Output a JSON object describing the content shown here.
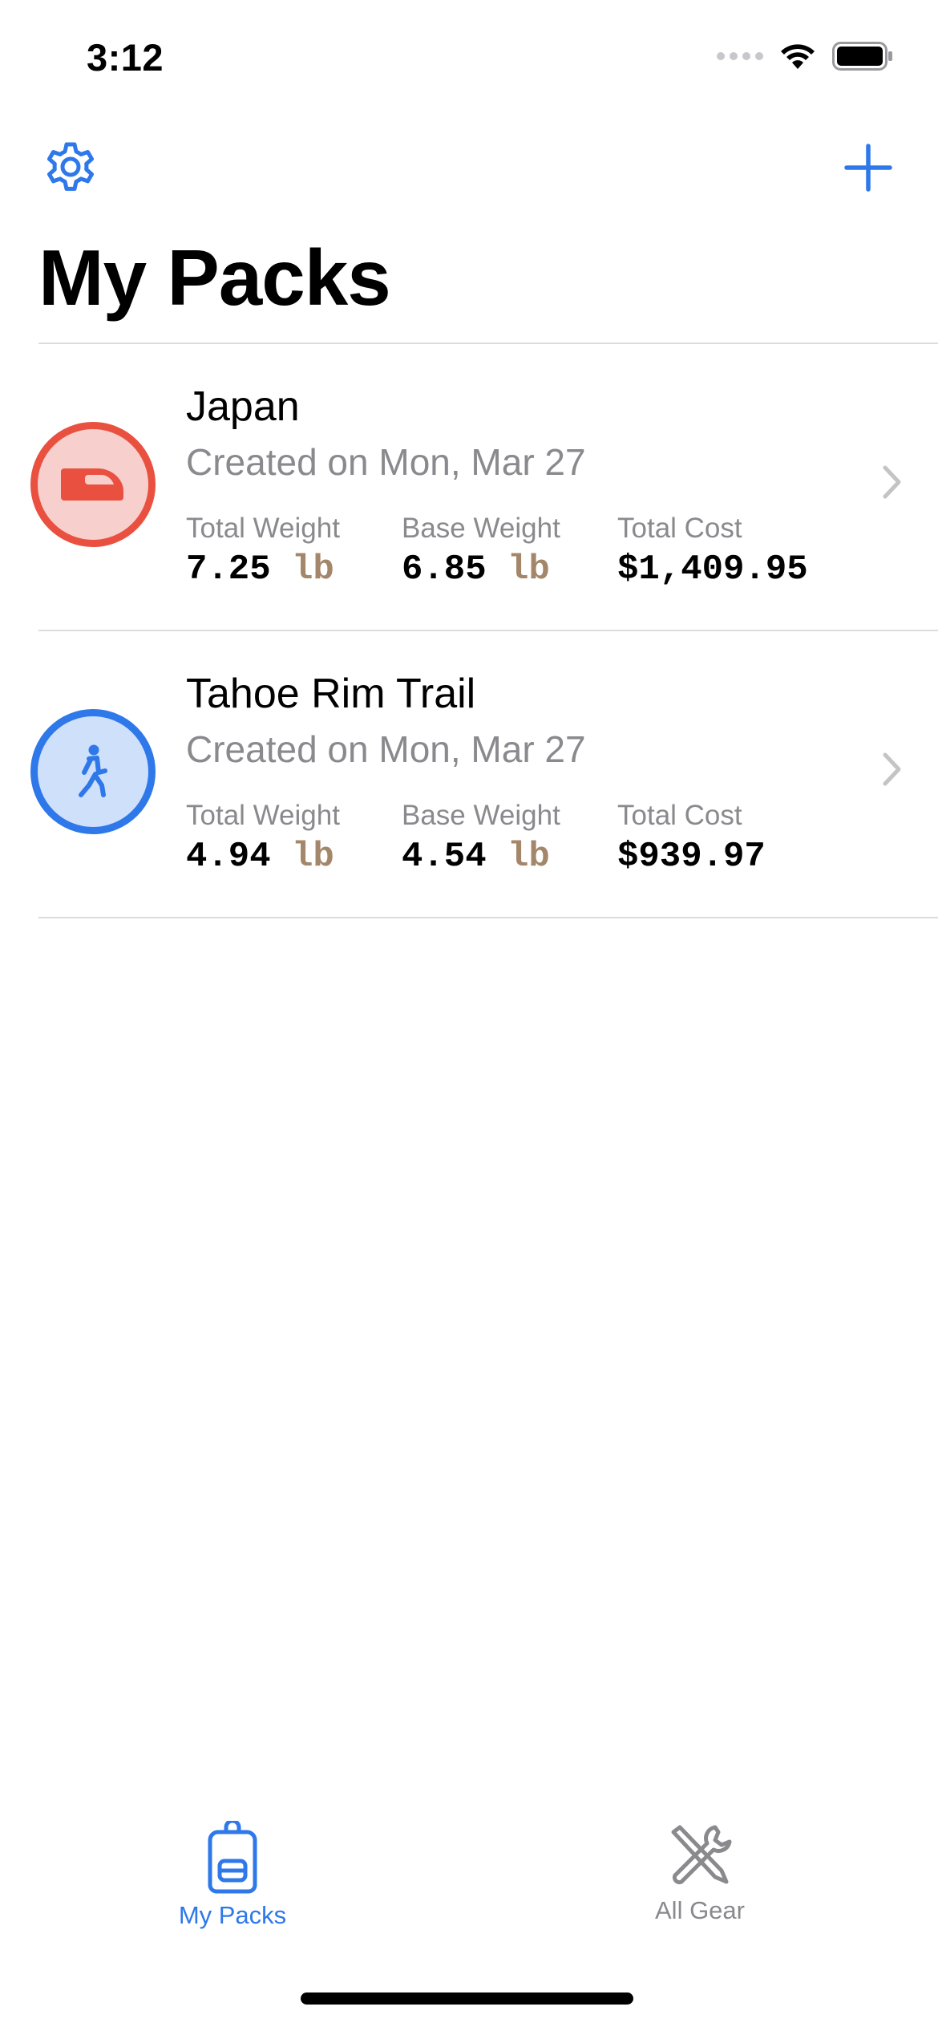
{
  "status_bar": {
    "time": "3:12"
  },
  "nav": {
    "settings_icon": "gear-icon",
    "add_icon": "plus-icon"
  },
  "title": "My Packs",
  "packs": [
    {
      "name": "Japan",
      "created": "Created on Mon, Mar 27",
      "icon": "train-icon",
      "accent": "#e9503f",
      "total_weight_label": "Total Weight",
      "total_weight": "7.25",
      "total_weight_unit": "lb",
      "base_weight_label": "Base Weight",
      "base_weight": "6.85",
      "base_weight_unit": "lb",
      "total_cost_label": "Total Cost",
      "total_cost": "$1,409.95"
    },
    {
      "name": "Tahoe Rim Trail",
      "created": "Created on Mon, Mar 27",
      "icon": "hiker-icon",
      "accent": "#2e78ea",
      "total_weight_label": "Total Weight",
      "total_weight": "4.94",
      "total_weight_unit": "lb",
      "base_weight_label": "Base Weight",
      "base_weight": "4.54",
      "base_weight_unit": "lb",
      "total_cost_label": "Total Cost",
      "total_cost": "$939.97"
    }
  ],
  "tabs": [
    {
      "label": "My Packs",
      "icon": "backpack-icon",
      "selected": true
    },
    {
      "label": "All Gear",
      "icon": "tools-icon",
      "selected": false
    }
  ],
  "colors": {
    "accent_blue": "#2e78ea",
    "unit_color": "#a4876a",
    "secondary_text": "#8a8a8e"
  }
}
